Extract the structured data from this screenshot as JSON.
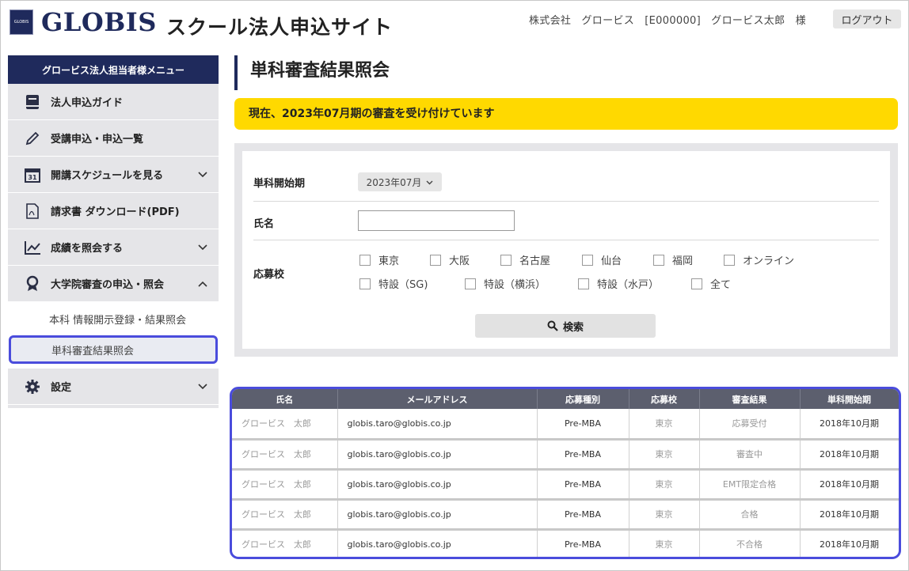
{
  "header": {
    "logo_small": "GLOBIS",
    "logo": "GLOBIS",
    "site_title": "スクール法人申込サイト",
    "user_info": "株式会社　グロービス　[E000000]　グロービス太郎　様",
    "logout_label": "ログアウト"
  },
  "sidebar": {
    "title": "グロービス法人担当者様メニュー",
    "items": [
      {
        "label": "法人申込ガイド",
        "icon": "book-icon"
      },
      {
        "label": "受講申込・申込一覧",
        "icon": "pencil-icon"
      },
      {
        "label": "開講スケジュールを見る",
        "icon": "calendar-icon"
      },
      {
        "label": "請求書 ダウンロード(PDF)",
        "icon": "pdf-icon"
      },
      {
        "label": "成績を照会する",
        "icon": "chart-icon"
      },
      {
        "label": "大学院審査の申込・照会",
        "icon": "award-icon"
      },
      {
        "label": "設定",
        "icon": "gear-icon"
      }
    ],
    "calendar_day": "31",
    "sub_items": [
      {
        "label": "本科 情報開示登録・結果照会"
      },
      {
        "label": "単科審査結果照会"
      }
    ]
  },
  "main": {
    "page_title": "単科審査結果照会",
    "notice": "現在、2023年07月期の審査を受け付けています",
    "search": {
      "term_label": "単科開始期",
      "term_value": "2023年07月",
      "name_label": "氏名",
      "name_value": "",
      "school_label": "応募校",
      "schools": [
        "東京",
        "大阪",
        "名古屋",
        "仙台",
        "福岡",
        "オンライン",
        "特設（SG)",
        "特設（横浜）",
        "特設（水戸）",
        "全て"
      ],
      "search_button": "検索"
    },
    "results": {
      "columns": [
        "氏名",
        "メールアドレス",
        "応募種別",
        "応募校",
        "審査結果",
        "単科開始期"
      ],
      "rows": [
        [
          "グロービス　太郎",
          "globis.taro@globis.co.jp",
          "Pre-MBA",
          "東京",
          "応募受付",
          "2018年10月期"
        ],
        [
          "グロービス　太郎",
          "globis.taro@globis.co.jp",
          "Pre-MBA",
          "東京",
          "審査中",
          "2018年10月期"
        ],
        [
          "グロービス　太郎",
          "globis.taro@globis.co.jp",
          "Pre-MBA",
          "東京",
          "EMT限定合格",
          "2018年10月期"
        ],
        [
          "グロービス　太郎",
          "globis.taro@globis.co.jp",
          "Pre-MBA",
          "東京",
          "合格",
          "2018年10月期"
        ],
        [
          "グロービス　太郎",
          "globis.taro@globis.co.jp",
          "Pre-MBA",
          "東京",
          "不合格",
          "2018年10月期"
        ]
      ]
    }
  },
  "colors": {
    "brand": "#1f2a5c",
    "notice": "#ffd900",
    "highlight": "#4a4cdc",
    "table_header": "#5c5f6e"
  }
}
